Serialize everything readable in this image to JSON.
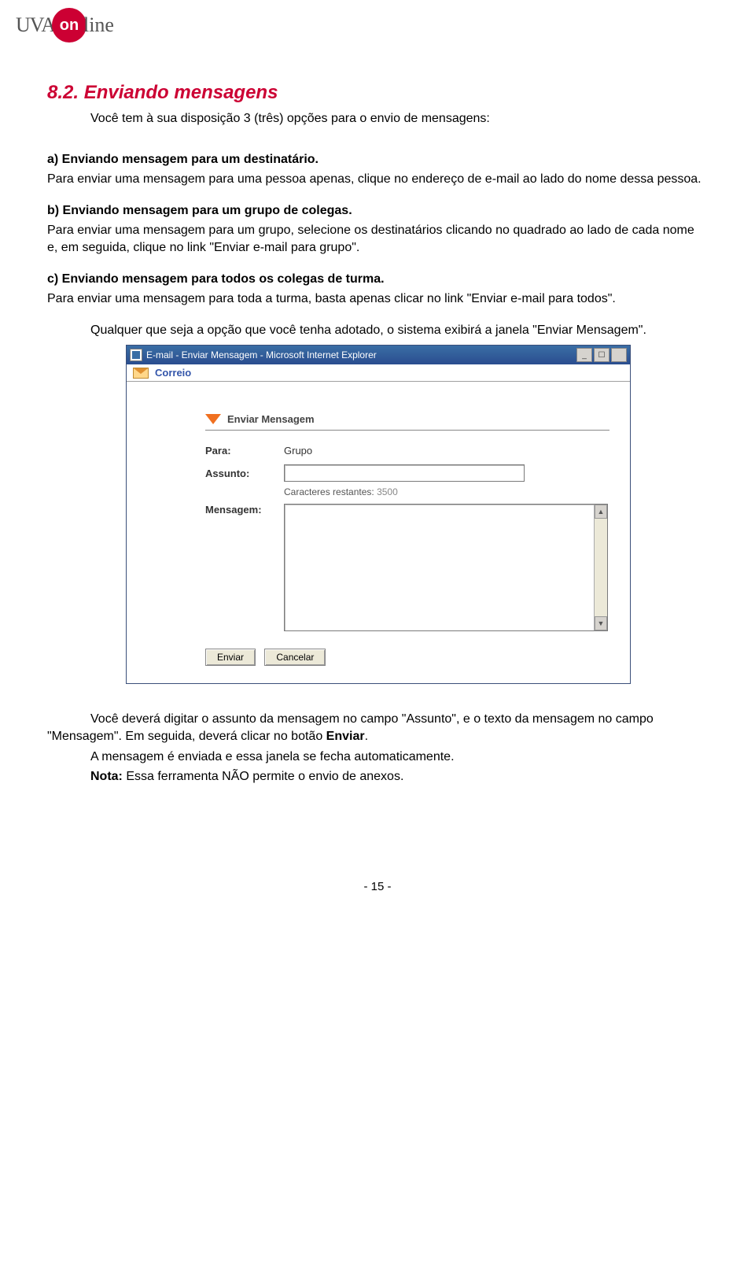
{
  "logo": {
    "uva": "UVA",
    "on": "on",
    "line": "line"
  },
  "section": {
    "title": "8.2. Enviando mensagens",
    "intro": "Você tem à sua disposição 3 (três) opções para o envio de mensagens:"
  },
  "item_a": {
    "heading": "a) Enviando mensagem para um destinatário.",
    "body": "Para enviar uma mensagem para uma pessoa apenas, clique no endereço de e-mail ao lado do nome dessa pessoa."
  },
  "item_b": {
    "heading": "b) Enviando mensagem para um grupo de colegas.",
    "body": "Para enviar uma mensagem para um grupo, selecione os destinatários clicando no quadrado ao lado de cada nome e, em seguida, clique no link \"Enviar e-mail para grupo\"."
  },
  "item_c": {
    "heading": "c) Enviando mensagem para todos os colegas de turma.",
    "body": "Para enviar uma mensagem para toda a turma, basta apenas clicar no link \"Enviar e-mail para todos\"."
  },
  "any_option": "Qualquer que seja a opção que você tenha adotado, o sistema exibirá a janela \"Enviar Mensagem\".",
  "window": {
    "title": "E-mail - Enviar Mensagem - Microsoft Internet Explorer",
    "correio": "Correio",
    "form_title": "Enviar Mensagem",
    "para_label": "Para:",
    "para_value": "Grupo",
    "assunto_label": "Assunto:",
    "chars_label": "Caracteres restantes:",
    "chars_value": "3500",
    "mensagem_label": "Mensagem:",
    "btn_enviar": "Enviar",
    "btn_cancelar": "Cancelar"
  },
  "after1_a": "Você deverá digitar o assunto da mensagem no campo \"Assunto\", e o texto da mensagem no campo \"Mensagem\". Em seguida, deverá clicar no botão ",
  "after1_b": "Enviar",
  "after1_c": ".",
  "after2": "A mensagem é enviada e essa janela se fecha automaticamente.",
  "note_label": "Nota:",
  "note_body": " Essa ferramenta NÃO permite o envio de anexos.",
  "page_number": "- 15 -"
}
